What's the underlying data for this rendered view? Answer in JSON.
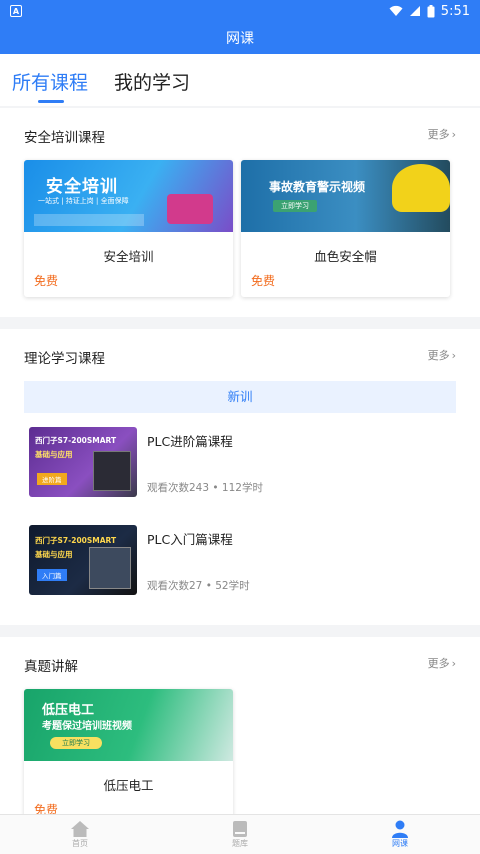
{
  "status": {
    "time": "5:51"
  },
  "app": {
    "title": "网课"
  },
  "tabs": [
    {
      "label": "所有课程"
    },
    {
      "label": "我的学习"
    }
  ],
  "sections": {
    "safety": {
      "title": "安全培训课程",
      "more": "更多",
      "cards": [
        {
          "thumb_text": "安全培训",
          "thumb_sub": "一站式 | 持证上岗 | 全面保障",
          "name": "安全培训",
          "price": "免费"
        },
        {
          "thumb_text": "事故教育警示视频",
          "thumb_sub": "立即学习",
          "name": "血色安全帽",
          "price": "免费"
        }
      ]
    },
    "theory": {
      "title": "理论学习课程",
      "more": "更多",
      "category": "新训",
      "courses": [
        {
          "thumb_line1": "西门子S7-200SMART",
          "thumb_line2": "基础与应用",
          "thumb_tag": "进阶篇",
          "title": "PLC进阶篇课程",
          "meta": "观看次数243 • 112学时"
        },
        {
          "thumb_line1": "西门子S7-200SMART",
          "thumb_line2": "基础与应用",
          "thumb_tag": "入门篇",
          "title": "PLC入门篇课程",
          "meta": "观看次数27 • 52学时"
        }
      ]
    },
    "exam": {
      "title": "真题讲解",
      "more": "更多",
      "cards": [
        {
          "thumb_text": "低压电工",
          "thumb_sub": "考题保过培训班视频",
          "thumb_btn": "立即学习",
          "name": "低压电工",
          "price": "免费"
        }
      ]
    }
  },
  "bottom_nav": [
    {
      "label": "首页"
    },
    {
      "label": "题库"
    },
    {
      "label": "网课"
    }
  ],
  "colors": {
    "primary": "#2f7df6",
    "price": "#f26b1d"
  }
}
